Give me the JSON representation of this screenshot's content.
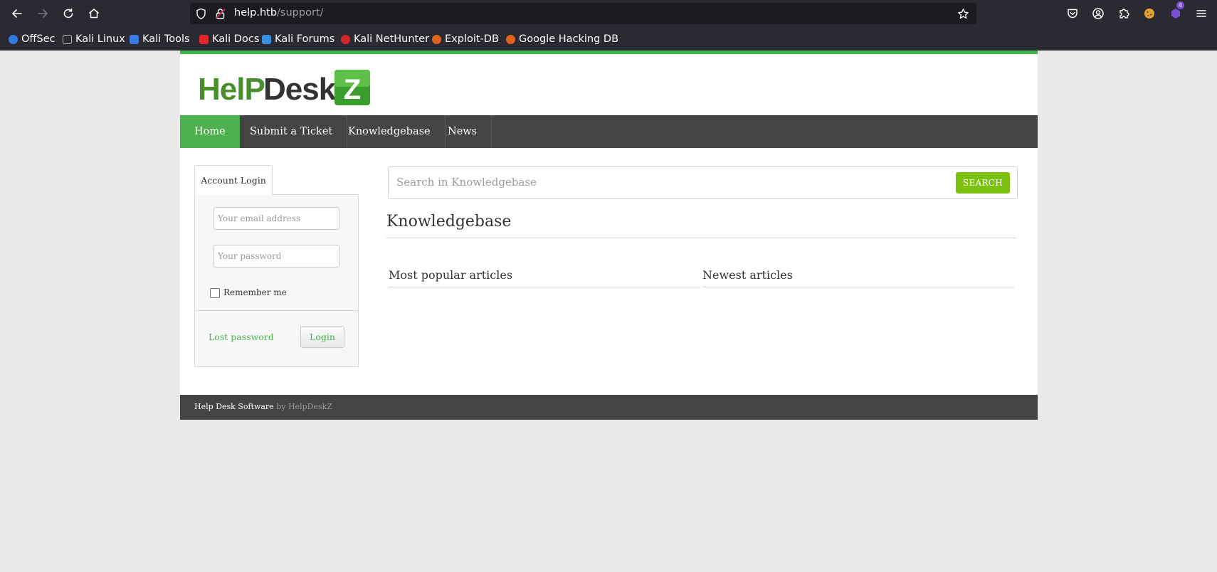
{
  "browser": {
    "url_host": "help.htb",
    "url_path": "/support/",
    "extension_badge": "4",
    "bookmarks": [
      {
        "label": "OffSec",
        "color": "#2f7de1"
      },
      {
        "label": "Kali Linux",
        "color": "#bbbbbb"
      },
      {
        "label": "Kali Tools",
        "color": "#3d7be0"
      },
      {
        "label": "Kali Docs",
        "color": "#e02828"
      },
      {
        "label": "Kali Forums",
        "color": "#3c8fe0"
      },
      {
        "label": "Kali NetHunter",
        "color": "#d22a2a"
      },
      {
        "label": "Exploit-DB",
        "color": "#e0641e"
      },
      {
        "label": "Google Hacking DB",
        "color": "#e0641e"
      }
    ]
  },
  "site": {
    "accent_color": "#4bb14f",
    "nav": [
      "Home",
      "Submit a Ticket",
      "Knowledgebase",
      "News"
    ],
    "login": {
      "tab_label": "Account Login",
      "email_placeholder": "Your email address",
      "password_placeholder": "Your password",
      "remember_label": "Remember me",
      "lost_password": "Lost password",
      "login_button": "Login"
    },
    "search": {
      "placeholder": "Search in Knowledgebase",
      "button": "SEARCH"
    },
    "kb_title": "Knowledgebase",
    "popular_title": "Most popular articles",
    "newest_title": "Newest articles",
    "footer": {
      "software": "Help Desk Software",
      "by": "by HelpDeskZ"
    }
  }
}
